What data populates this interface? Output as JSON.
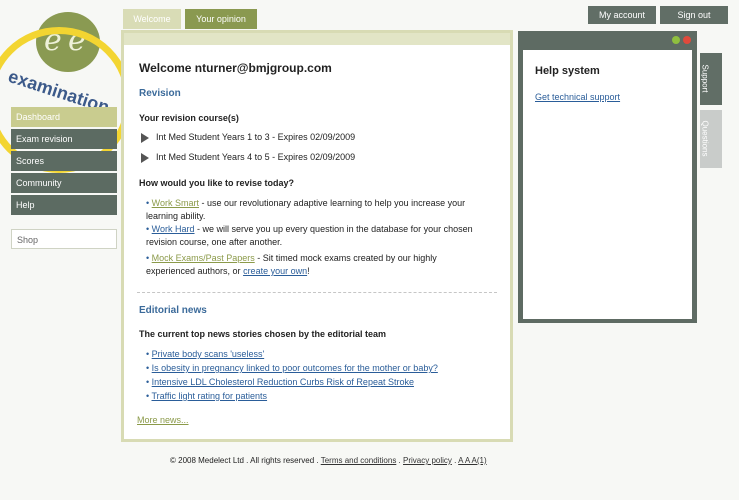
{
  "header": {
    "my_account": "My account",
    "sign_out": "Sign out",
    "tabs": [
      "Welcome",
      "Your opinion"
    ]
  },
  "logo": {
    "text": "examination"
  },
  "sidebar": {
    "items": [
      "Dashboard",
      "Exam revision",
      "Scores",
      "Community",
      "Help"
    ],
    "shop": "Shop"
  },
  "main": {
    "welcome": "Welcome nturner@bmjgroup.com",
    "revision_heading": "Revision",
    "courses_heading": "Your revision course(s)",
    "courses": [
      "Int Med Student Years 1 to 3 - Expires 02/09/2009",
      "Int Med Student Years 4 to 5 - Expires 02/09/2009"
    ],
    "revise_question": "How would you like to revise today?",
    "options": [
      {
        "link": "Work Smart",
        "text": " - use our revolutionary adaptive learning to help you increase your learning ability."
      },
      {
        "link": "Work Hard",
        "text": " - we will serve you up every question in the database for your chosen revision course, one after another."
      },
      {
        "link": "Mock Exams/Past Papers",
        "text": " - Sit timed mock exams created by our highly experienced authors, or ",
        "link2": "create your own",
        "end": "!"
      }
    ],
    "editorial_heading": "Editorial news",
    "editorial_sub": "The current top news stories chosen by the editorial team",
    "news": [
      "Private body scans 'useless'",
      "Is obesity in pregnancy linked to poor outcomes for the mother or baby?",
      "Intensive LDL Cholesterol Reduction Curbs Risk of Repeat Stroke",
      "Traffic light rating for patients"
    ],
    "more_news": "More news..."
  },
  "help": {
    "title": "Help system",
    "link": "Get technical support",
    "tabs": [
      "Support",
      "Questions"
    ]
  },
  "footer": {
    "copyright": "© 2008 Medelect Ltd . All rights reserved .",
    "terms": "Terms and conditions",
    "sep": ".",
    "privacy": "Privacy policy",
    "sizes": "A A A(1)"
  },
  "colors": {
    "accent": "#c9cc8f",
    "dark": "#5c6b62",
    "link": "#2a5d99",
    "heading": "#3b6a9a",
    "ring": "#f3d531"
  }
}
